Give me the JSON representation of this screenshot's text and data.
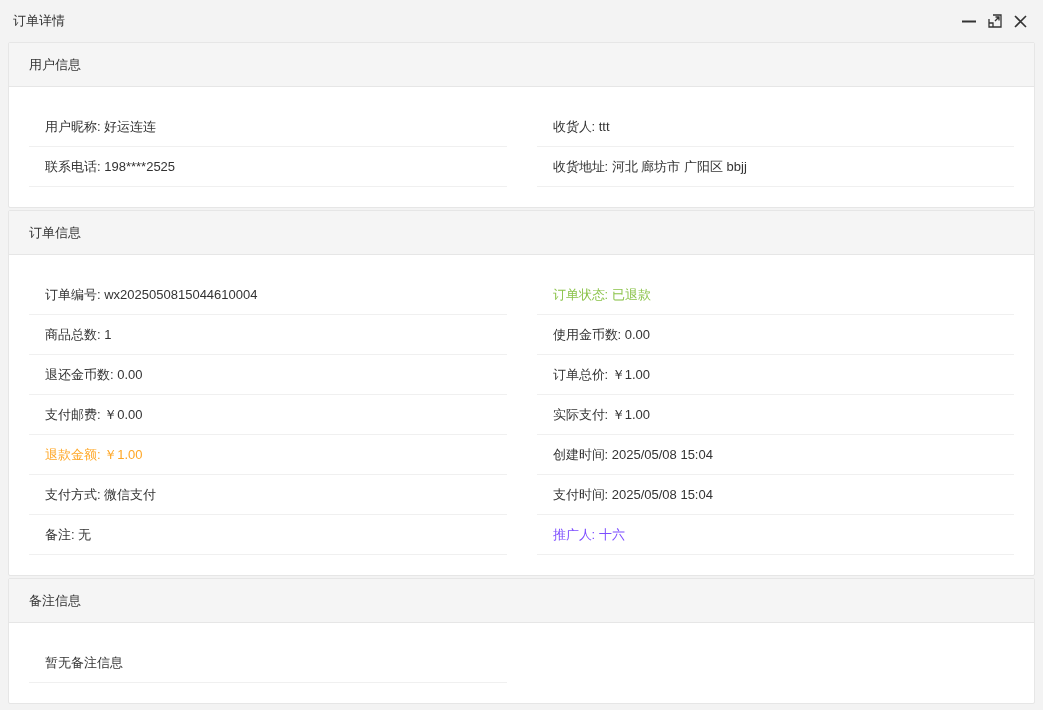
{
  "window": {
    "title": "订单详情"
  },
  "sections": [
    {
      "title": "用户信息",
      "items": [
        {
          "text": "用户昵称: 好运连连"
        },
        {
          "text": "收货人: ttt"
        },
        {
          "text": "联系电话: 198****2525"
        },
        {
          "text": "收货地址: 河北 廊坊市 广阳区 bbjj"
        }
      ]
    },
    {
      "title": "订单信息",
      "items": [
        {
          "text": "订单编号: wx2025050815044610004"
        },
        {
          "text": "订单状态: 已退款",
          "color": "#8bc34a"
        },
        {
          "text": "商品总数: 1"
        },
        {
          "text": "使用金币数: 0.00"
        },
        {
          "text": "退还金币数: 0.00"
        },
        {
          "text": "订单总价: ￥1.00"
        },
        {
          "text": "支付邮费: ￥0.00"
        },
        {
          "text": "实际支付: ￥1.00"
        },
        {
          "text": "退款金额: ￥1.00",
          "color": "#ffa726"
        },
        {
          "text": "创建时间: 2025/05/08 15:04"
        },
        {
          "text": "支付方式: 微信支付"
        },
        {
          "text": "支付时间: 2025/05/08 15:04"
        },
        {
          "text": "备注: 无"
        },
        {
          "text": "推广人: 十六",
          "color": "#7c4dff"
        }
      ]
    },
    {
      "title": "备注信息",
      "items": [
        {
          "text": "暂无备注信息"
        }
      ]
    }
  ]
}
